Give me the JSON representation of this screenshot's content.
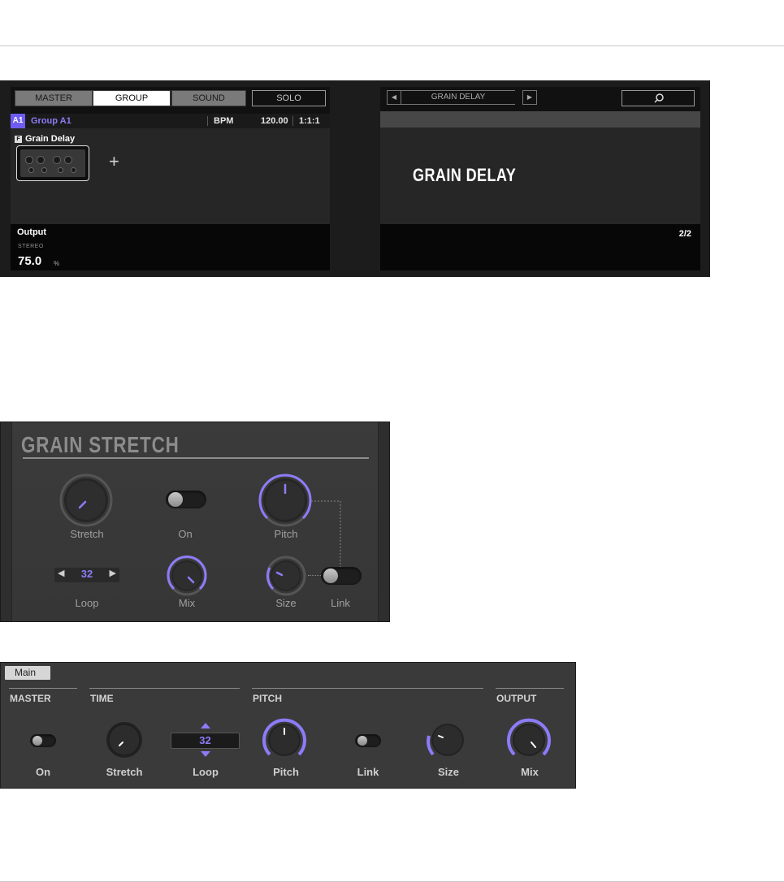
{
  "hardware": {
    "tabs": [
      {
        "label": "MASTER",
        "state": "off"
      },
      {
        "label": "GROUP",
        "state": "on"
      },
      {
        "label": "SOUND",
        "state": "off"
      },
      {
        "label": "SOLO",
        "state": "outline"
      }
    ],
    "group": {
      "badge": "A1",
      "name": "Group A1",
      "bpm_label": "BPM",
      "bpm_value": "120.00",
      "position": "1:1:1"
    },
    "plugin": {
      "icon_letter": "F",
      "name": "Grain Delay"
    },
    "output": {
      "label": "Output",
      "sublabel": "STEREO",
      "value": "75.0",
      "unit": "%"
    },
    "browser": {
      "title": "GRAIN DELAY",
      "big_title": "GRAIN DELAY",
      "page": "2/2"
    },
    "accent": "#6e5cf2"
  },
  "panel": {
    "title": "GRAIN STRETCH",
    "labels": {
      "stretch": "Stretch",
      "on": "On",
      "pitch": "Pitch",
      "loop": "Loop",
      "mix": "Mix",
      "size": "Size",
      "link": "Link"
    },
    "loop_value": "32"
  },
  "strip": {
    "tab": "Main",
    "sections": {
      "master": "MASTER",
      "time": "TIME",
      "pitch": "PITCH",
      "output": "OUTPUT"
    },
    "labels": {
      "on": "On",
      "stretch": "Stretch",
      "loop": "Loop",
      "pitch": "Pitch",
      "link": "Link",
      "size": "Size",
      "mix": "Mix"
    },
    "loop_value": "32"
  }
}
